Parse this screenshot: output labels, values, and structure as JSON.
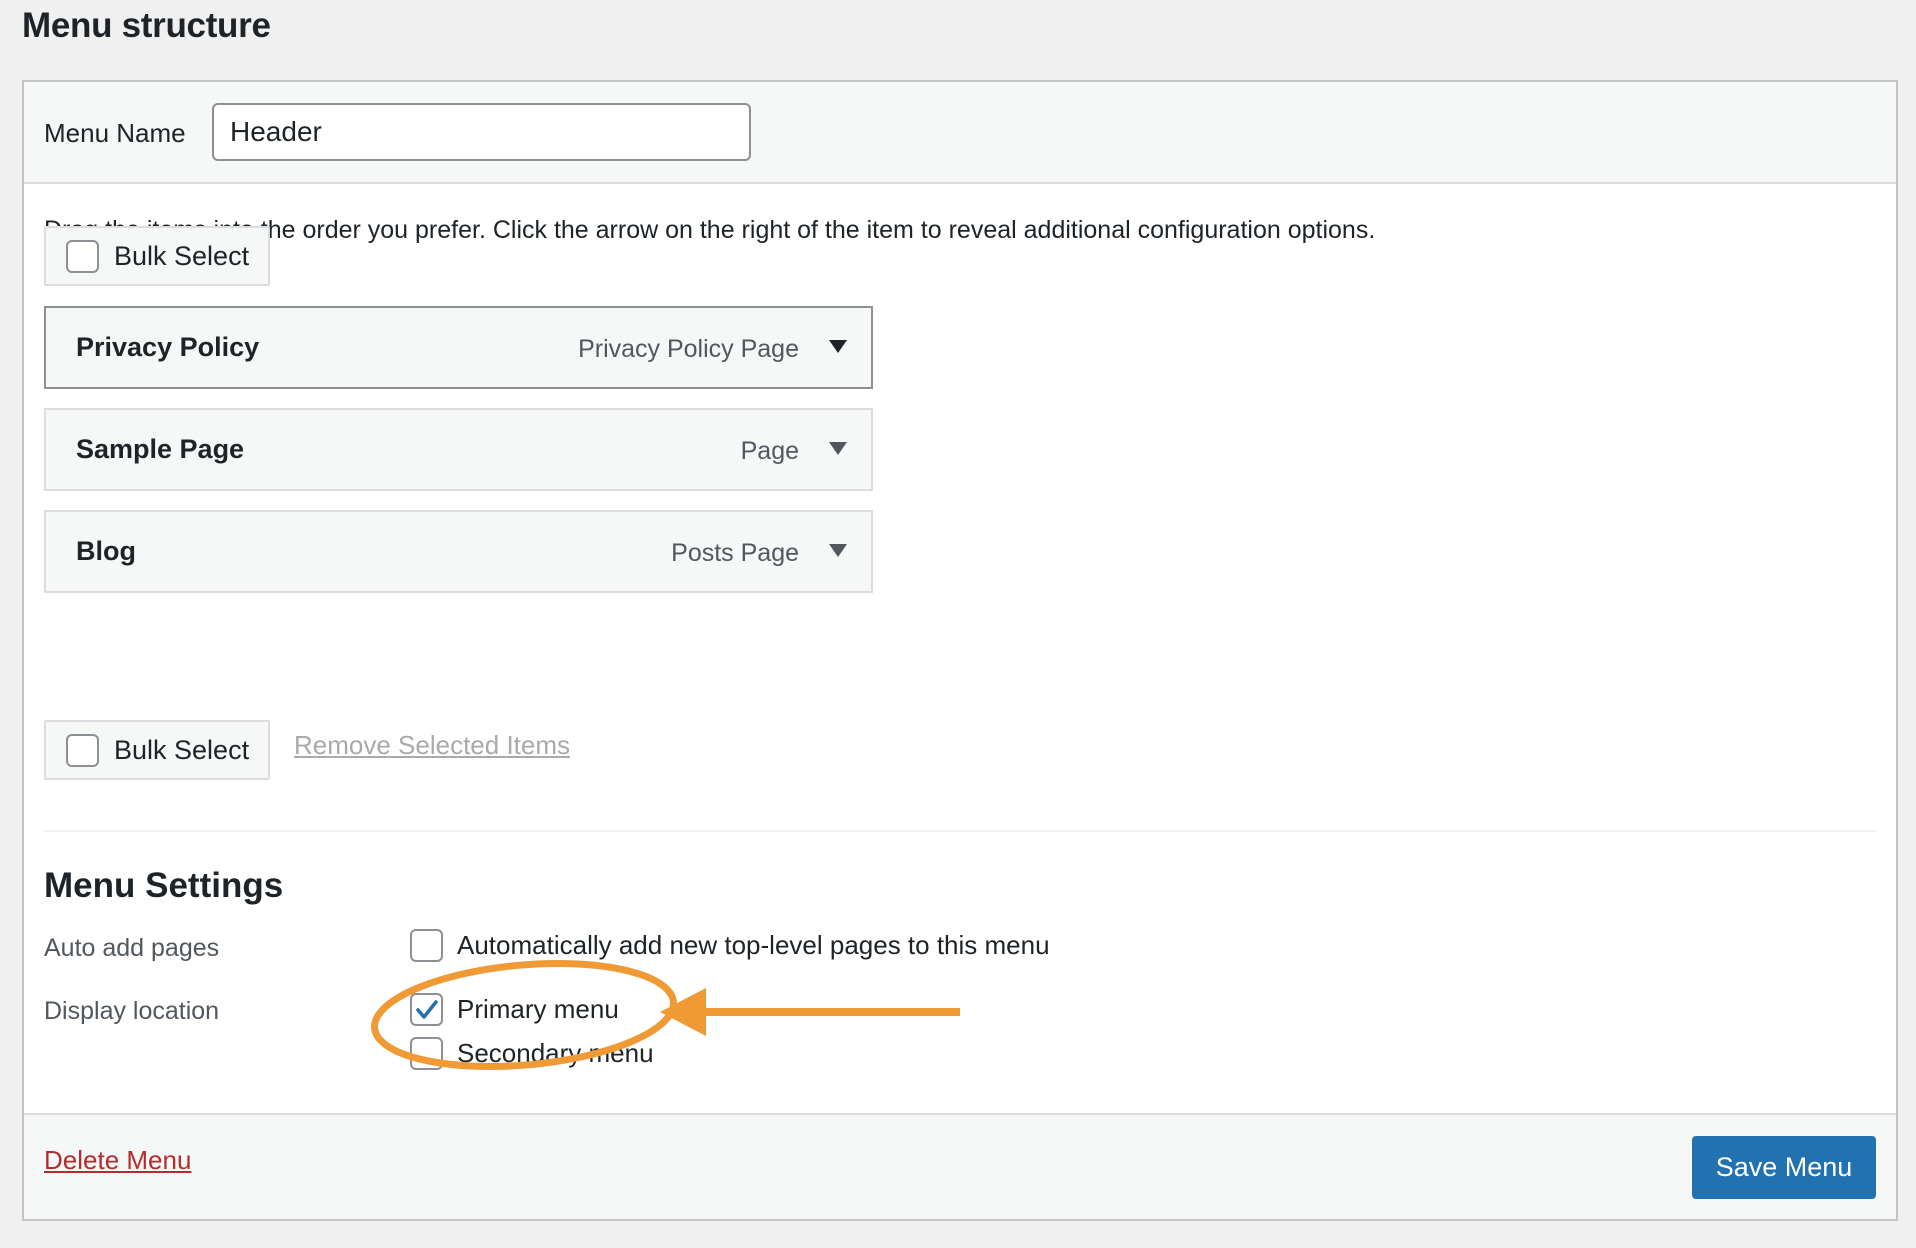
{
  "page": {
    "title": "Menu structure"
  },
  "menu_name": {
    "label": "Menu Name",
    "value": "Header"
  },
  "instructions": "Drag the items into the order you prefer. Click the arrow on the right of the item to reveal additional configuration options.",
  "bulk_select": {
    "label": "Bulk Select",
    "checked": false
  },
  "menu_items": [
    {
      "title": "Privacy Policy",
      "type": "Privacy Policy Page",
      "icon": "chevron-down-icon"
    },
    {
      "title": "Sample Page",
      "type": "Page",
      "icon": "chevron-down-icon"
    },
    {
      "title": "Blog",
      "type": "Posts Page",
      "icon": "chevron-down-icon"
    }
  ],
  "remove_selected": "Remove Selected Items",
  "settings": {
    "title": "Menu Settings",
    "auto_add": {
      "label": "Auto add pages",
      "option": "Automatically add new top-level pages to this menu",
      "checked": false
    },
    "display_location": {
      "label": "Display location",
      "options": [
        {
          "label": "Primary menu",
          "checked": true
        },
        {
          "label": "Secondary menu",
          "checked": false
        }
      ]
    }
  },
  "footer": {
    "delete_label": "Delete Menu",
    "save_label": "Save Menu"
  },
  "colors": {
    "primary_button": "#2271b1",
    "delete_link": "#b32d2e",
    "annotation": "#f09a36",
    "checkmark": "#2271b1"
  }
}
